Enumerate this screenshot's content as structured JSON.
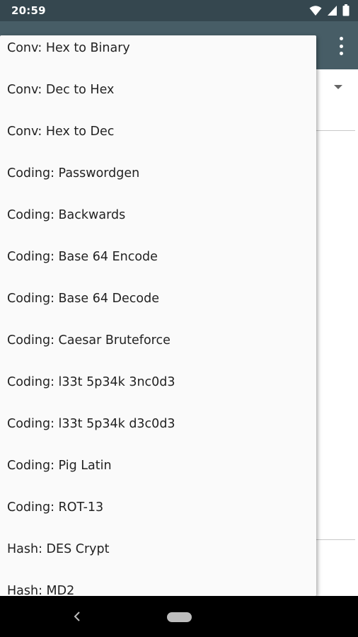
{
  "status_bar": {
    "time": "20:59",
    "icons": [
      "wifi-icon",
      "signal-icon",
      "battery-icon"
    ]
  },
  "app_bar": {
    "overflow_icon": "more-vert-icon"
  },
  "dropdown": {
    "items": [
      "Conv: Hex to Binary",
      "Conv: Dec to Hex",
      "Conv: Hex to Dec",
      "Coding: Passwordgen",
      "Coding: Backwards",
      "Coding: Base 64 Encode",
      "Coding: Base 64 Decode",
      "Coding: Caesar Bruteforce",
      "Coding: l33t 5p34k 3nc0d3",
      "Coding: l33t 5p34k d3c0d3",
      "Coding: Pig Latin",
      "Coding: ROT-13",
      "Hash: DES Crypt",
      "Hash: MD2"
    ]
  },
  "nav_bar": {
    "back_icon": "back-icon",
    "home_icon": "home-pill-icon"
  },
  "colors": {
    "status_bar": "#35474f",
    "app_bar": "#475d66",
    "dropdown_bg": "#fafafa",
    "nav_bar": "#000000"
  }
}
